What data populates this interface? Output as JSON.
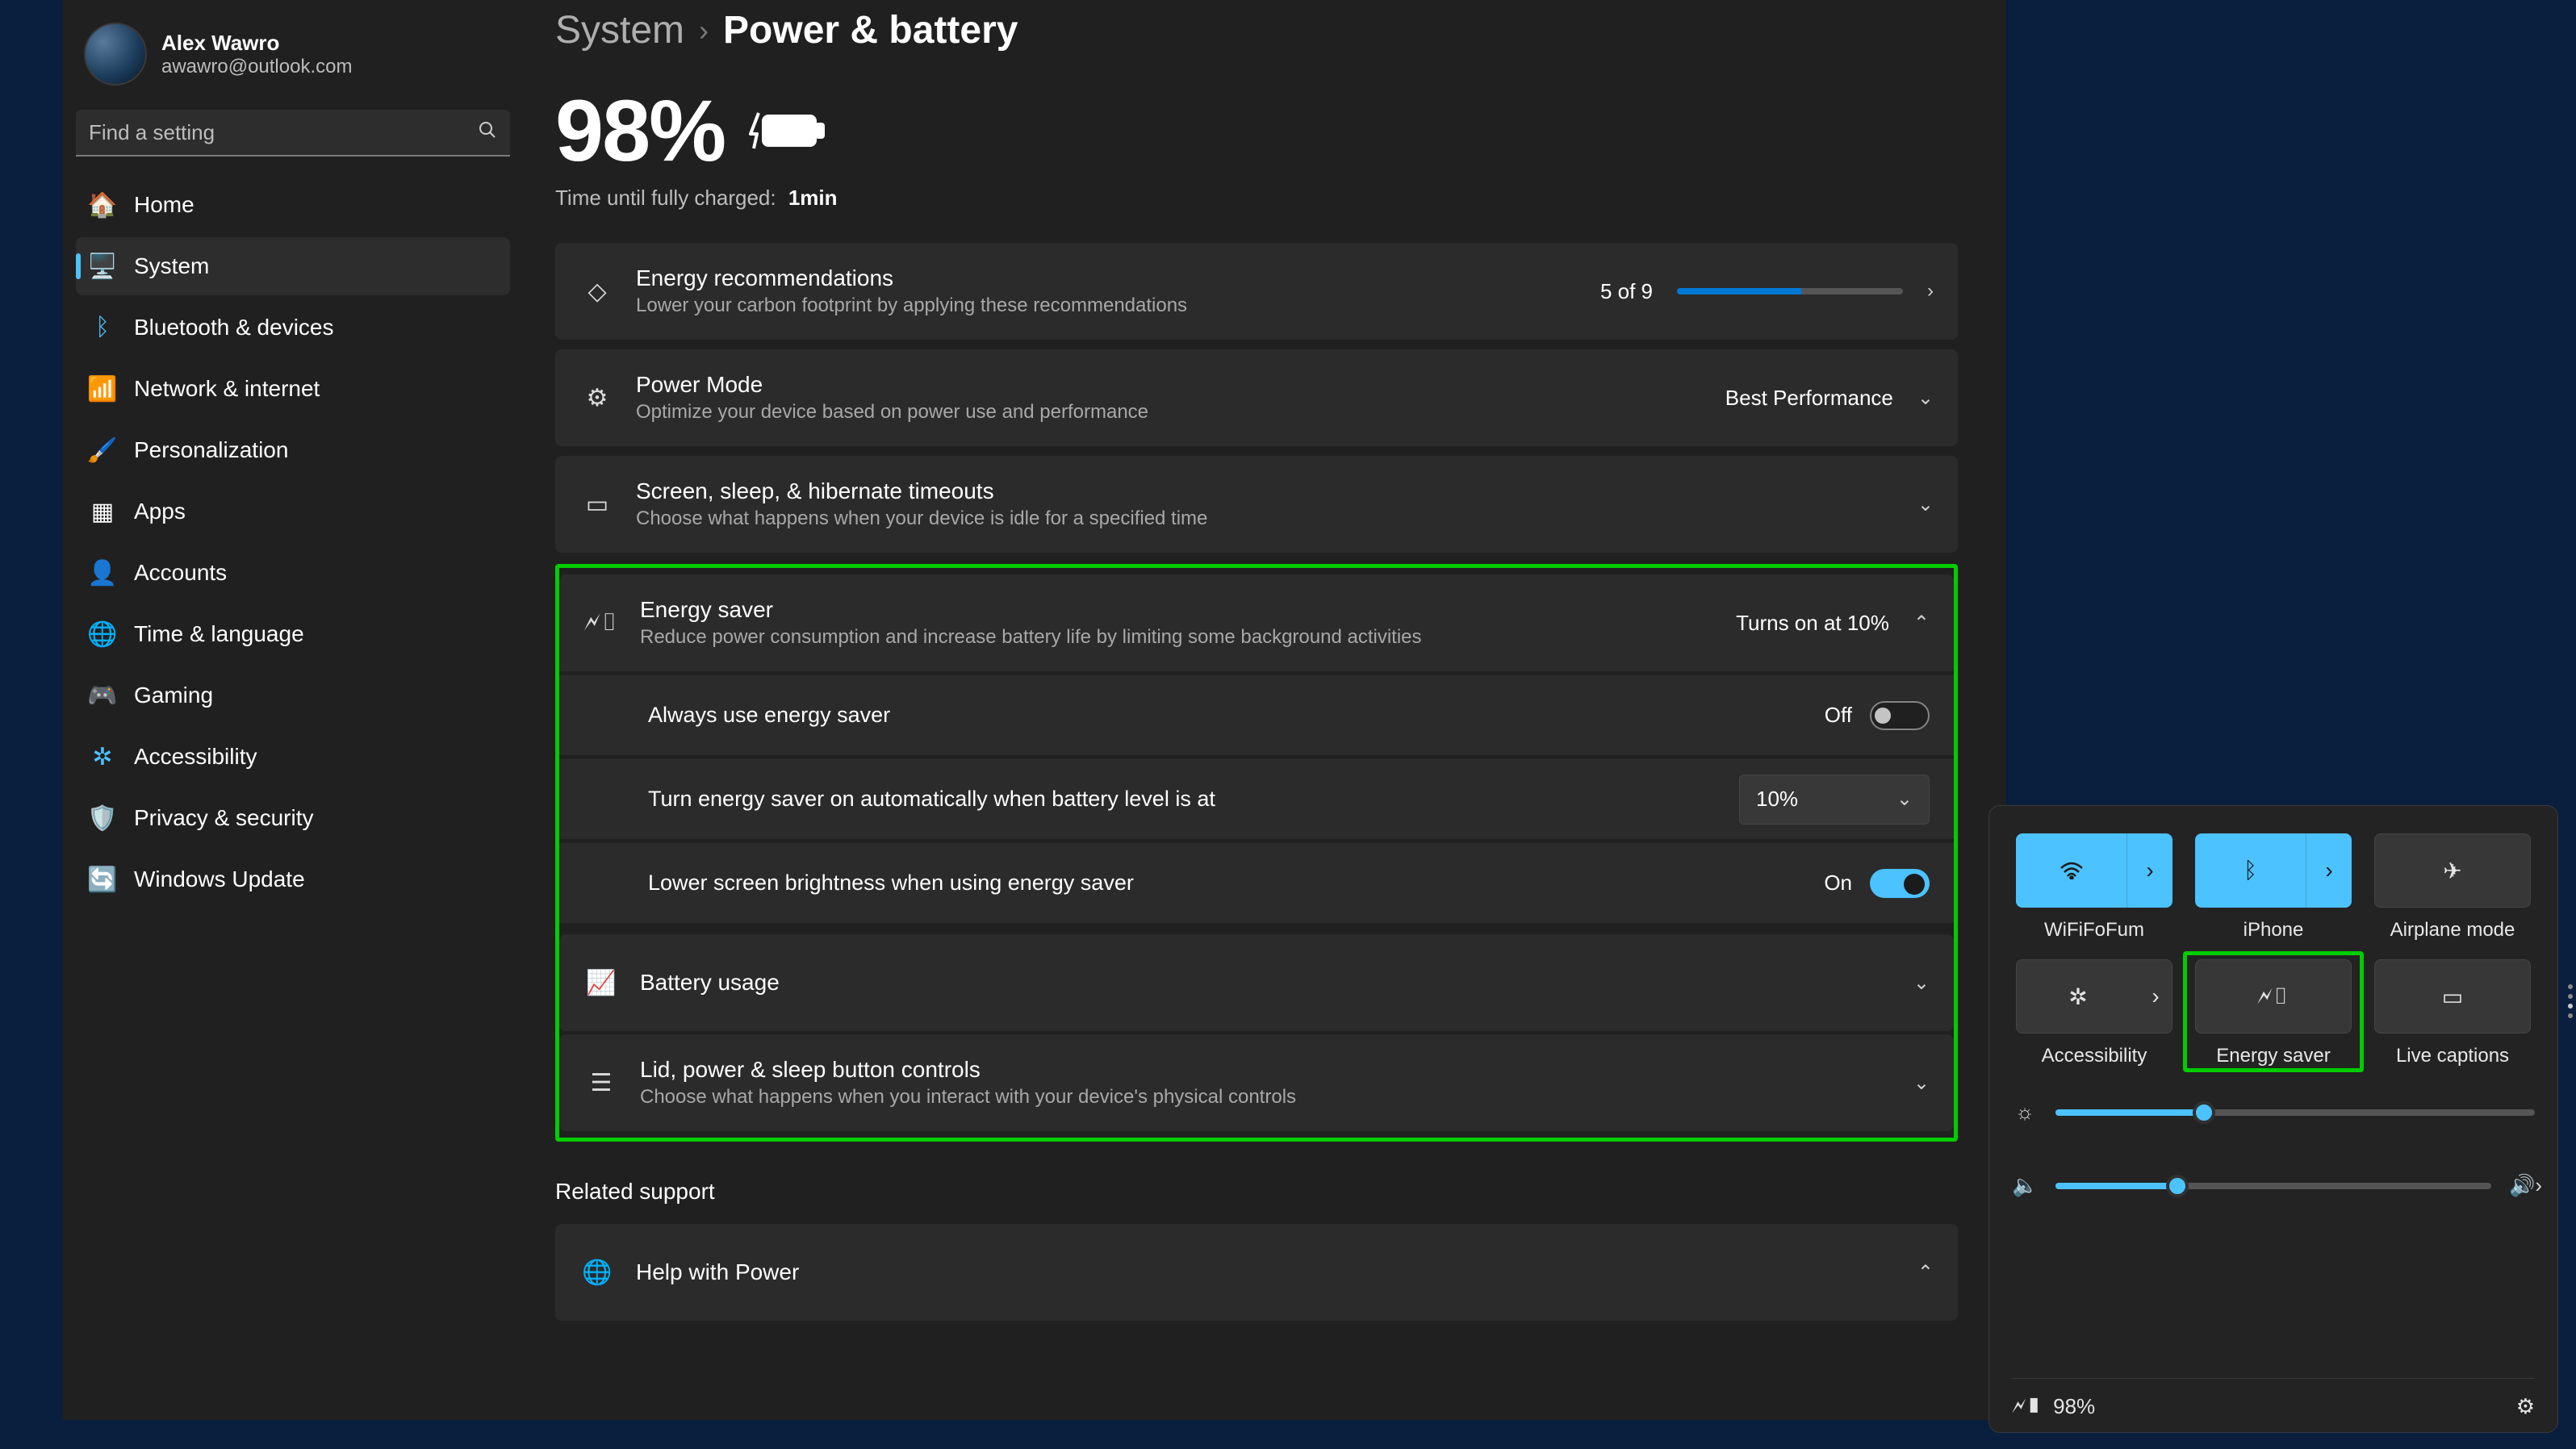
{
  "user": {
    "name": "Alex Wawro",
    "email": "awawro@outlook.com"
  },
  "search": {
    "placeholder": "Find a setting"
  },
  "nav": {
    "home": "Home",
    "system": "System",
    "bluetooth": "Bluetooth & devices",
    "network": "Network & internet",
    "personalization": "Personalization",
    "apps": "Apps",
    "accounts": "Accounts",
    "time": "Time & language",
    "gaming": "Gaming",
    "accessibility": "Accessibility",
    "privacy": "Privacy & security",
    "update": "Windows Update"
  },
  "breadcrumb": {
    "root": "System",
    "current": "Power & battery"
  },
  "battery": {
    "percent": "98%",
    "time_label": "Time until fully charged:",
    "time_value": "1min"
  },
  "energy_rec": {
    "title": "Energy recommendations",
    "sub": "Lower your carbon footprint by applying these recommendations",
    "count": "5 of 9"
  },
  "power_mode": {
    "title": "Power Mode",
    "sub": "Optimize your device based on power use and performance",
    "value": "Best Performance"
  },
  "timeouts": {
    "title": "Screen, sleep, & hibernate timeouts",
    "sub": "Choose what happens when your device is idle for a specified time"
  },
  "energy_saver": {
    "title": "Energy saver",
    "sub": "Reduce power consumption and increase battery life by limiting some background activities",
    "status": "Turns on at 10%",
    "always": {
      "label": "Always use energy saver",
      "state": "Off"
    },
    "auto": {
      "label": "Turn energy saver on automatically when battery level is at",
      "value": "10%"
    },
    "lower": {
      "label": "Lower screen brightness when using energy saver",
      "state": "On"
    }
  },
  "battery_usage": {
    "title": "Battery usage"
  },
  "lid": {
    "title": "Lid, power & sleep button controls",
    "sub": "Choose what happens when you interact with your device's physical controls"
  },
  "related": {
    "heading": "Related support",
    "help": "Help with Power"
  },
  "quick": {
    "wifi": "WiFiFoFum",
    "bluetooth": "iPhone",
    "airplane": "Airplane mode",
    "accessibility": "Accessibility",
    "energy_saver": "Energy saver",
    "captions": "Live captions",
    "brightness_pct": 31,
    "volume_pct": 28,
    "battery": "98%"
  }
}
